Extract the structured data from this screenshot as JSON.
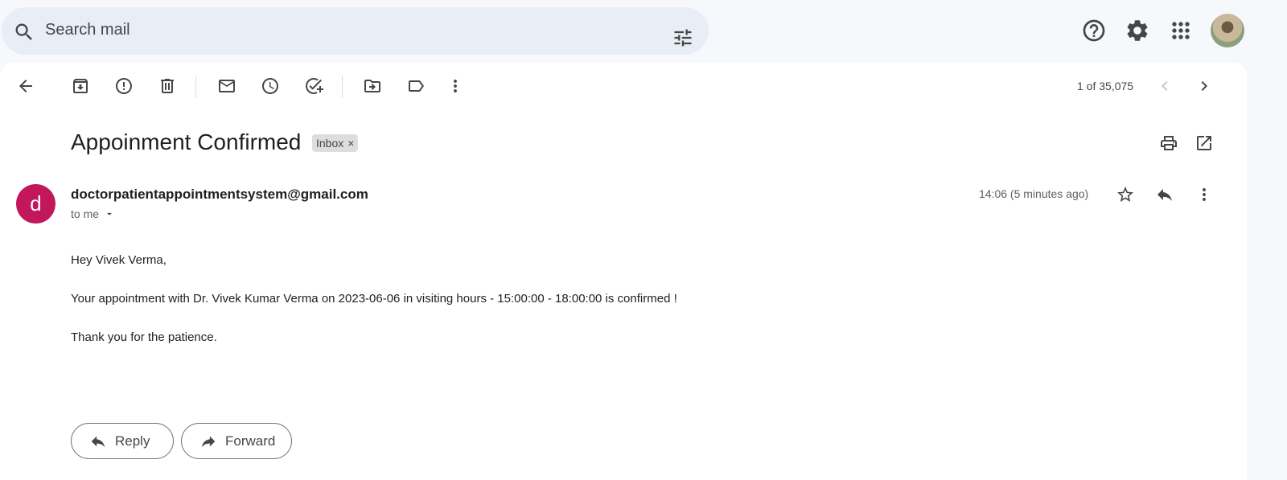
{
  "search": {
    "placeholder": "Search mail"
  },
  "toolbar": {
    "pager": "1 of 35,075"
  },
  "message": {
    "subject": "Appoinment Confirmed",
    "label": "Inbox",
    "label_remove": "×",
    "avatar_letter": "d",
    "sender": "doctorpatientappointmentsystem@gmail.com",
    "to": "to me",
    "time": "14:06 (5 minutes ago)",
    "body": [
      "Hey Vivek Verma,",
      "Your appointment with Dr. Vivek Kumar Verma on 2023-06-06 in visiting hours - 15:00:00 - 18:00:00 is confirmed !",
      "Thank you for the patience."
    ]
  },
  "actions": {
    "reply": "Reply",
    "forward": "Forward"
  },
  "colors": {
    "avatar": "#c2185b",
    "search_bg": "#e9eef6",
    "page_bg": "#f6f8fc"
  },
  "icons": [
    "search-icon",
    "tune-icon",
    "help-icon",
    "settings-icon",
    "apps-icon",
    "back-icon",
    "archive-icon",
    "report-spam-icon",
    "delete-icon",
    "mark-unread-icon",
    "snooze-icon",
    "add-task-icon",
    "move-to-icon",
    "label-icon",
    "more-vert-icon",
    "chevron-left-icon",
    "chevron-right-icon",
    "print-icon",
    "open-new-window-icon",
    "star-icon",
    "reply-icon",
    "forward-icon"
  ]
}
